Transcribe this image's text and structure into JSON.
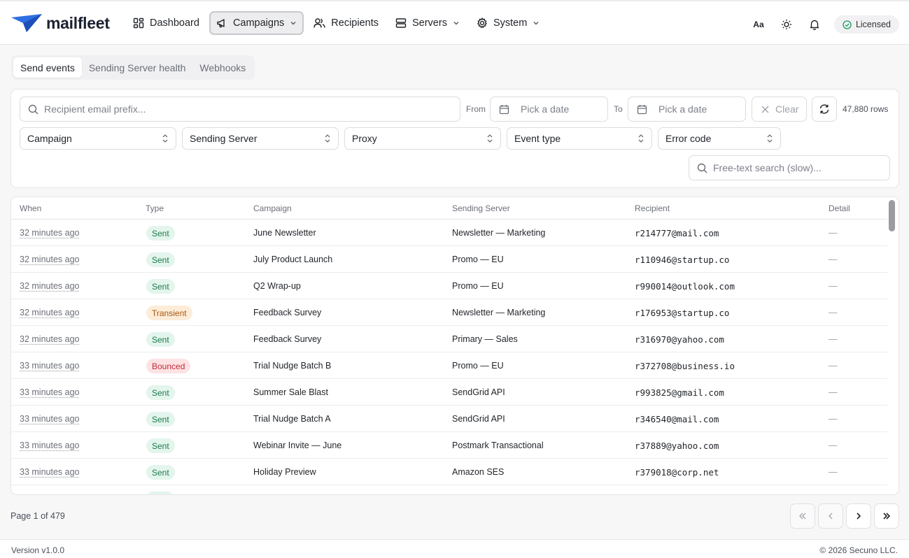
{
  "brand": {
    "name": "mailfleet",
    "accent": "#2f6fe4"
  },
  "nav": {
    "dashboard": "Dashboard",
    "campaigns": "Campaigns",
    "recipients": "Recipients",
    "servers": "Servers",
    "system": "System"
  },
  "header": {
    "font_toggle": "Aa",
    "licensed": "Licensed",
    "icons": [
      "font-size-icon",
      "sun-icon",
      "bell-icon",
      "check-circle-icon"
    ]
  },
  "tabs": [
    "Send events",
    "Sending Server health",
    "Webhooks"
  ],
  "filters": {
    "email_placeholder": "Recipient email prefix...",
    "from_label": "From",
    "to_label": "To",
    "date_placeholder": "Pick a date",
    "clear": "Clear",
    "rows": "47,880 rows",
    "selects": [
      "Campaign",
      "Sending Server",
      "Proxy",
      "Event type",
      "Error code"
    ],
    "freetext_placeholder": "Free-text search (slow)..."
  },
  "table": {
    "columns": [
      "When",
      "Type",
      "Campaign",
      "Sending Server",
      "Recipient",
      "Detail"
    ],
    "badge_colors": {
      "Sent": {
        "bg": "#e3f5ec",
        "fg": "#1e7a4f"
      },
      "Transient": {
        "bg": "#fdecd8",
        "fg": "#a55a10"
      },
      "Bounced": {
        "bg": "#fde2e4",
        "fg": "#c22b3a"
      }
    },
    "rows": [
      {
        "when": "32 minutes ago",
        "type": "Sent",
        "campaign": "June Newsletter",
        "server": "Newsletter — Marketing",
        "recipient": "r214777@mail.com",
        "detail": "—"
      },
      {
        "when": "32 minutes ago",
        "type": "Sent",
        "campaign": "July Product Launch",
        "server": "Promo — EU",
        "recipient": "r110946@startup.co",
        "detail": "—"
      },
      {
        "when": "32 minutes ago",
        "type": "Sent",
        "campaign": "Q2 Wrap-up",
        "server": "Promo — EU",
        "recipient": "r990014@outlook.com",
        "detail": "—"
      },
      {
        "when": "32 minutes ago",
        "type": "Transient",
        "campaign": "Feedback Survey",
        "server": "Newsletter — Marketing",
        "recipient": "r176953@startup.co",
        "detail": "—"
      },
      {
        "when": "32 minutes ago",
        "type": "Sent",
        "campaign": "Feedback Survey",
        "server": "Primary — Sales",
        "recipient": "r316970@yahoo.com",
        "detail": "—"
      },
      {
        "when": "33 minutes ago",
        "type": "Bounced",
        "campaign": "Trial Nudge Batch B",
        "server": "Promo — EU",
        "recipient": "r372708@business.io",
        "detail": "—"
      },
      {
        "when": "33 minutes ago",
        "type": "Sent",
        "campaign": "Summer Sale Blast",
        "server": "SendGrid API",
        "recipient": "r993825@gmail.com",
        "detail": "—"
      },
      {
        "when": "33 minutes ago",
        "type": "Sent",
        "campaign": "Trial Nudge Batch A",
        "server": "SendGrid API",
        "recipient": "r346540@mail.com",
        "detail": "—"
      },
      {
        "when": "33 minutes ago",
        "type": "Sent",
        "campaign": "Webinar Invite — June",
        "server": "Postmark Transactional",
        "recipient": "r37889@yahoo.com",
        "detail": "—"
      },
      {
        "when": "33 minutes ago",
        "type": "Sent",
        "campaign": "Holiday Preview",
        "server": "Amazon SES",
        "recipient": "r379018@corp.net",
        "detail": "—"
      }
    ]
  },
  "pagination": {
    "info": "Page 1 of 479"
  },
  "footer": {
    "version": "Version v1.0.0",
    "copyright": "© 2026 Secuno LLC."
  }
}
